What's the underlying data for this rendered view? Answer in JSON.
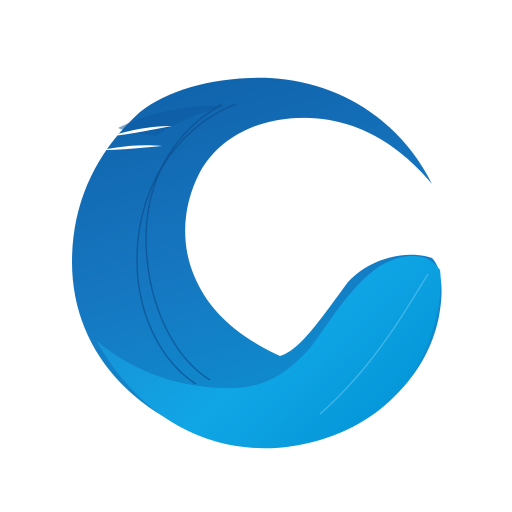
{
  "icon": {
    "name": "feather-c-logo-icon",
    "colors": {
      "background": "#ffffff",
      "dark_blue": "#0F60A8",
      "mid_blue": "#1676C0",
      "light_blue": "#0496D8",
      "bright_blue": "#10A6E6",
      "line": "#0B4F8E",
      "highlight": "#5EC4F0"
    }
  }
}
